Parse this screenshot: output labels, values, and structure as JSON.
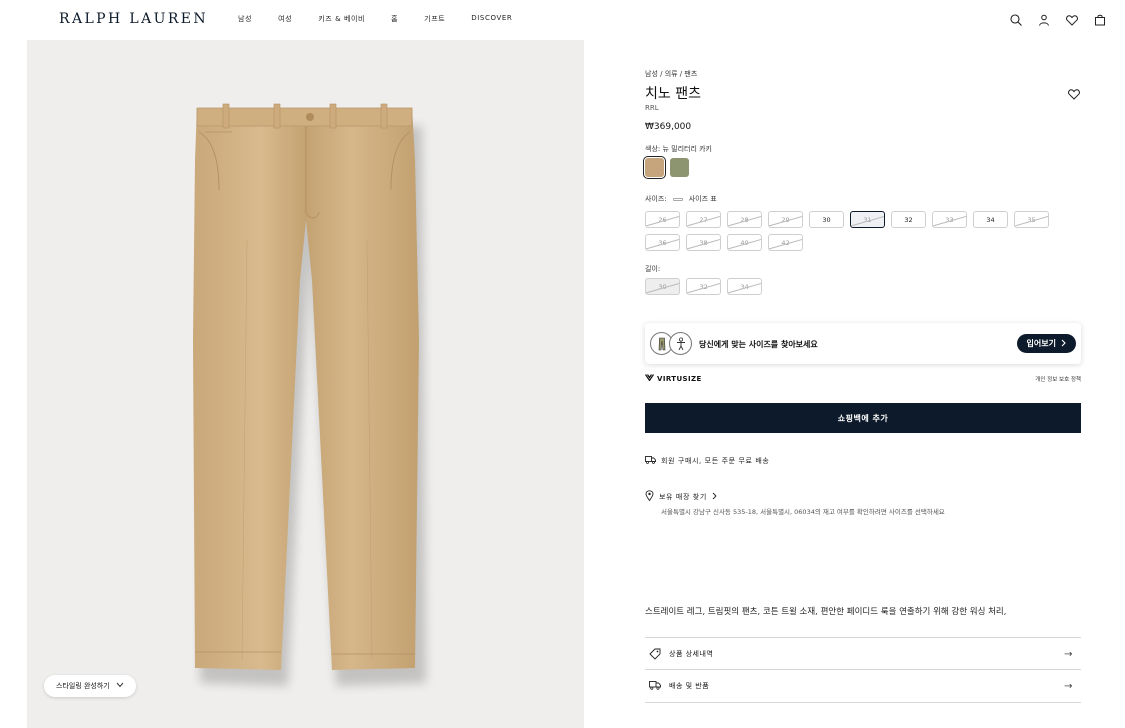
{
  "header": {
    "logo": "RALPH LAUREN",
    "nav": [
      "남성",
      "여성",
      "키즈 & 베이비",
      "홈",
      "기프트",
      "DISCOVER"
    ],
    "icons": [
      "search-icon",
      "account-icon",
      "wishlist-icon",
      "bag-icon"
    ]
  },
  "image": {
    "style_button": "스타일링 완성하기"
  },
  "product": {
    "breadcrumb": "남성 / 의류 / 팬츠",
    "title": "치노 팬츠",
    "brand": "RRL",
    "price": "₩369,000",
    "color_label": "색상: 뉴 밀리터리 카키",
    "swatches": [
      "#c7a57c",
      "#8d9470"
    ],
    "size_label": "사이즈:",
    "size_chart": "사이즈 표",
    "sizes": [
      {
        "label": "26",
        "available": false
      },
      {
        "label": "27",
        "available": false
      },
      {
        "label": "28",
        "available": false
      },
      {
        "label": "29",
        "available": false
      },
      {
        "label": "30",
        "available": true
      },
      {
        "label": "31",
        "available": false,
        "selected": true
      },
      {
        "label": "32",
        "available": true
      },
      {
        "label": "33",
        "available": false
      },
      {
        "label": "34",
        "available": true
      },
      {
        "label": "35",
        "available": false
      },
      {
        "label": "36",
        "available": false
      },
      {
        "label": "38",
        "available": false
      },
      {
        "label": "40",
        "available": false
      },
      {
        "label": "42",
        "available": false
      }
    ],
    "length_label": "길이:",
    "lengths": [
      {
        "label": "30",
        "available": false
      },
      {
        "label": "32",
        "available": false
      },
      {
        "label": "34",
        "available": false
      }
    ]
  },
  "virtusize": {
    "prompt": "당신에게 맞는 사이즈를 찾아보세요",
    "button": "입어보기",
    "logo": "VIRTUSIZE",
    "privacy": "개인 정보 보호 정책"
  },
  "add_to_bag": "쇼핑백에 추가",
  "shipping_note": "회원 구매시, 모든 주문 무료 배송",
  "store": {
    "label": "보유 매장 찾기",
    "sub": "서울특별시 강남구 신사동 535-18, 서울특별시, 06034의 재고 여부를 확인하려면 사이즈를 선택하세요"
  },
  "description": "스트레이트 레그, 트림핏의 팬츠, 코튼 트윌 소재, 편안한 페이디드 룩을 연출하기 위해 강한 워싱 처리,",
  "accordion": [
    "상품 상세내역",
    "배송 및 반품"
  ]
}
